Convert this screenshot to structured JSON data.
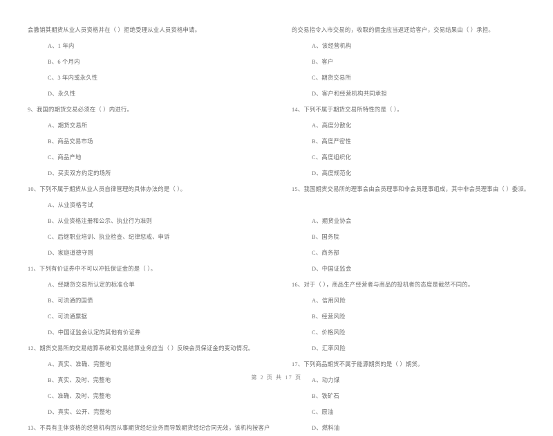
{
  "document": {
    "background_color": "#ffffff",
    "text_color": "#6b6b6b",
    "footer": "第 2 页 共 17 页"
  },
  "left_column": {
    "blocks": [
      {
        "kind": "stem_continuation",
        "text": "会撤销其期货从业人员资格并在（     ）拒绝受理从业人员资格申请。"
      },
      {
        "kind": "option",
        "text": "A、1 年内"
      },
      {
        "kind": "option",
        "text": "B、6 个月内"
      },
      {
        "kind": "option",
        "text": "C、3 年内或永久性"
      },
      {
        "kind": "option",
        "text": "D、永久性"
      },
      {
        "kind": "stem",
        "number": "9、",
        "text": "9、我国的期货交易必须在（     ）内进行。"
      },
      {
        "kind": "option",
        "text": "A、期货交易所"
      },
      {
        "kind": "option",
        "text": "B、商品交易市场"
      },
      {
        "kind": "option",
        "text": "C、商品产地"
      },
      {
        "kind": "option",
        "text": "D、买卖双方约定的场所"
      },
      {
        "kind": "stem",
        "number": "10、",
        "text": "10、下列不属于期货从业人员自律管理的具体办法的是（     ）。"
      },
      {
        "kind": "option",
        "text": "A、从业资格考试"
      },
      {
        "kind": "option",
        "text": "B、从业资格注册和公示、执业行为准则"
      },
      {
        "kind": "option",
        "text": "C、后继职业培训、执业检查、纪律惩戒、申诉"
      },
      {
        "kind": "option",
        "text": "D、家庭道德守则"
      },
      {
        "kind": "stem",
        "number": "11、",
        "text": "11、下列有价证券中不可以冲抵保证金的是（     ）。"
      },
      {
        "kind": "option",
        "text": "A、经期货交易所认定的标准仓单"
      },
      {
        "kind": "option",
        "text": "B、可流通的国债"
      },
      {
        "kind": "option",
        "text": "C、可流通票据"
      },
      {
        "kind": "option",
        "text": "D、中国证监会认定的其他有价证券"
      },
      {
        "kind": "stem",
        "number": "12、",
        "text": "12、期货交易所的交易结算系统和交易结算业务应当（     ）反映会员保证金的变动情况。"
      },
      {
        "kind": "option",
        "text": "A、真实、准确、完整地"
      },
      {
        "kind": "option",
        "text": "B、真实、及时、完整地"
      },
      {
        "kind": "option",
        "text": "C、准确、及时、完整地"
      },
      {
        "kind": "option",
        "text": "D、真实、公开、完整地"
      },
      {
        "kind": "stem",
        "number": "13、",
        "text": "13、不具有主体资格的经营机构因从事期货经纪业务而导致期货经纪合同无效，该机构按客户"
      }
    ]
  },
  "right_column": {
    "blocks": [
      {
        "kind": "stem_continuation",
        "text": "的交易指令入市交易的，收取的佣金应当返还给客户，交易结果由（     ）承担。"
      },
      {
        "kind": "option",
        "text": "A、该经营机构"
      },
      {
        "kind": "option",
        "text": "B、客户"
      },
      {
        "kind": "option",
        "text": "C、期货交易所"
      },
      {
        "kind": "option",
        "text": "D、客户和经营机构共同承担"
      },
      {
        "kind": "stem",
        "number": "14、",
        "text": "14、下列不属于期货交易所特性的是（     ）。"
      },
      {
        "kind": "option",
        "text": "A、高度分散化"
      },
      {
        "kind": "option",
        "text": "B、高度严密性"
      },
      {
        "kind": "option",
        "text": "C、高度组织化"
      },
      {
        "kind": "option",
        "text": "D、高度规范化"
      },
      {
        "kind": "stem",
        "number": "15、",
        "text": "15、我国期货交易所的理事会由会员理事和非会员理事组成，其中非会员理事由（     ）委派。"
      },
      {
        "kind": "spacer"
      },
      {
        "kind": "option",
        "text": "A、期货业协会"
      },
      {
        "kind": "option",
        "text": "B、国务院"
      },
      {
        "kind": "option",
        "text": "C、商务部"
      },
      {
        "kind": "option",
        "text": "D、中国证监会"
      },
      {
        "kind": "stem",
        "number": "16、",
        "text": "16、对于（     ），商品生产经营者与商品的投机者的态度是截然不同的。"
      },
      {
        "kind": "option",
        "text": "A、信用风险"
      },
      {
        "kind": "option",
        "text": "B、经营风险"
      },
      {
        "kind": "option",
        "text": "C、价格风险"
      },
      {
        "kind": "option",
        "text": "D、汇率风险"
      },
      {
        "kind": "stem",
        "number": "17、",
        "text": "17、下列商品期货不属于能源期货的是（     ）期货。"
      },
      {
        "kind": "option",
        "text": "A、动力煤"
      },
      {
        "kind": "option",
        "text": "B、铁矿石"
      },
      {
        "kind": "option",
        "text": "C、原油"
      },
      {
        "kind": "option",
        "text": "D、燃料油"
      }
    ]
  }
}
